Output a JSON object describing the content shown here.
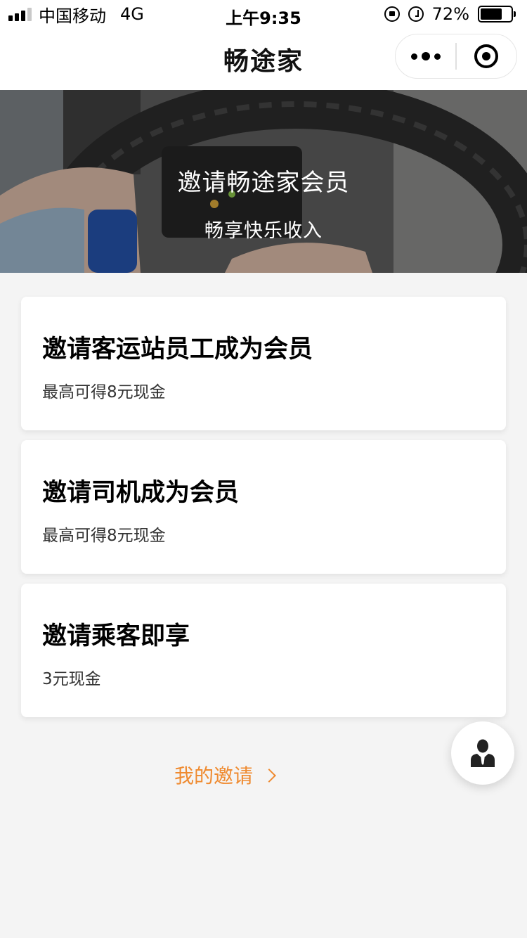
{
  "status_bar": {
    "carrier": "中国移动",
    "network": "4G",
    "time": "上午9:35",
    "battery_percent": "72%",
    "battery_level": 0.72,
    "icons": [
      "signal-icon",
      "orientation-lock-icon",
      "alarm-icon",
      "battery-icon"
    ]
  },
  "nav": {
    "title": "畅途家",
    "more_icon": "more-dots-icon",
    "close_icon": "target-circle-icon"
  },
  "banner": {
    "title": "邀请畅途家会员",
    "subtitle": "畅享快乐收入"
  },
  "cards": [
    {
      "title": "邀请客运站员工成为会员",
      "subtitle": "最高可得8元现金"
    },
    {
      "title": "邀请司机成为会员",
      "subtitle": "最高可得8元现金"
    },
    {
      "title": "邀请乘客即享",
      "subtitle": "3元现金"
    }
  ],
  "my_invite": {
    "label": "我的邀请",
    "icon": "chevron-right-icon"
  },
  "fab": {
    "icon": "customer-service-person-icon"
  },
  "colors": {
    "accent": "#ef8a2f",
    "background": "#f4f4f4",
    "card": "#ffffff"
  }
}
